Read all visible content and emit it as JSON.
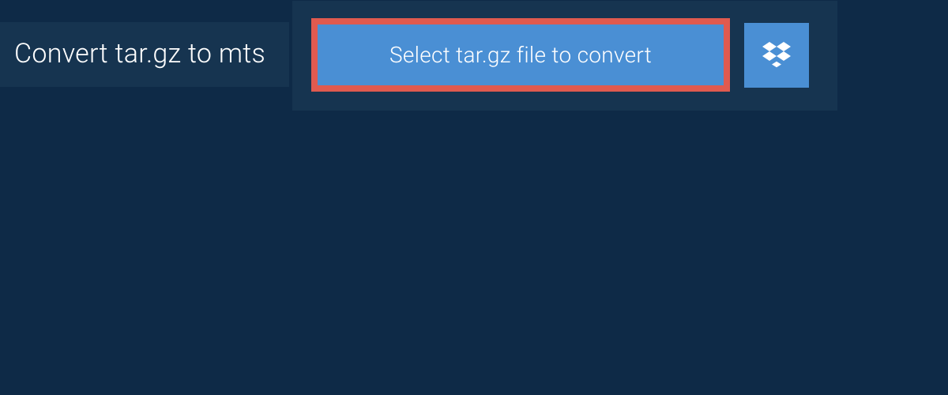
{
  "header": {
    "title": "Convert tar.gz to mts"
  },
  "upload": {
    "select_button_label": "Select tar.gz file to convert",
    "dropbox_icon": "dropbox-icon"
  },
  "colors": {
    "background": "#0e2a47",
    "panel": "#163450",
    "button": "#4a8fd4",
    "highlight_border": "#e05a4f",
    "text": "#ffffff"
  }
}
